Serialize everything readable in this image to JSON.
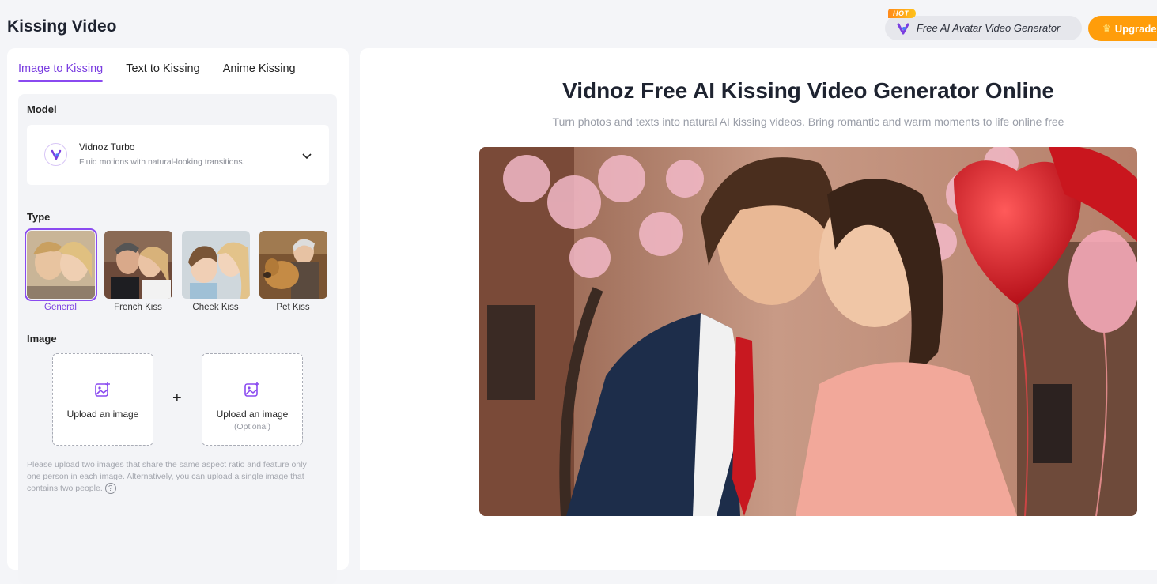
{
  "header": {
    "title": "Kissing Video",
    "hot_badge": "HOT",
    "avatar_link": "Free AI Avatar Video Generator",
    "upgrade_label": "Upgrade"
  },
  "tabs": [
    {
      "label": "Image to Kissing",
      "active": true
    },
    {
      "label": "Text to Kissing",
      "active": false
    },
    {
      "label": "Anime Kissing",
      "active": false
    }
  ],
  "model": {
    "section_label": "Model",
    "name": "Vidnoz Turbo",
    "description": "Fluid motions with natural-looking transitions."
  },
  "type": {
    "section_label": "Type",
    "items": [
      {
        "label": "General",
        "selected": true
      },
      {
        "label": "French Kiss",
        "selected": false
      },
      {
        "label": "Cheek Kiss",
        "selected": false
      },
      {
        "label": "Pet Kiss",
        "selected": false
      }
    ]
  },
  "image": {
    "section_label": "Image",
    "upload_1": {
      "label": "Upload an image"
    },
    "upload_2": {
      "label": "Upload an image",
      "sub": "(Optional)"
    },
    "plus": "+",
    "hint": "Please upload two images that share the same aspect ratio and feature only one person in each image. Alternatively, you can upload a single image that contains two people."
  },
  "hero": {
    "title": "Vidnoz Free AI Kissing Video Generator Online",
    "subtitle": "Turn photos and texts into natural AI kissing videos. Bring romantic and warm moments to life online free"
  },
  "colors": {
    "accent": "#8a4af0",
    "upgrade": "#ff9d0a",
    "background": "#f4f5f8"
  }
}
